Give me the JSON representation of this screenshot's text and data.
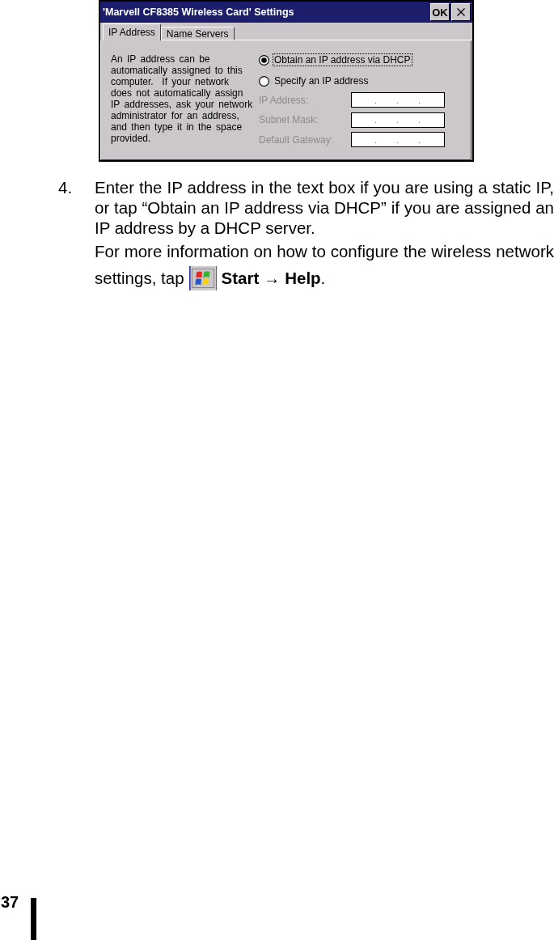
{
  "dialog": {
    "title": "'Marvell CF8385 Wireless Card' Settings",
    "ok_button": "OK",
    "tabs": [
      {
        "label": "IP Address",
        "selected": true
      },
      {
        "label": "Name Servers",
        "selected": false
      }
    ],
    "description": "An IP address can be automatically assigned to this computer.  If your network does not automatically assign IP addresses, ask your network administrator for an address, and then type it in the space provided.",
    "radios": [
      {
        "label": "Obtain an IP address via DHCP",
        "selected": true,
        "focused": true
      },
      {
        "label": "Specify an IP address",
        "selected": false,
        "focused": false
      }
    ],
    "fields": [
      {
        "label": "IP Address:",
        "disabled": true,
        "separators": [
          ".",
          ".",
          "."
        ]
      },
      {
        "label": "Subnet Mask:",
        "disabled": true,
        "separators": [
          ".",
          ".",
          "."
        ]
      },
      {
        "label": "Default Gateway:",
        "disabled": true,
        "separators": [
          ".",
          ".",
          "."
        ]
      }
    ]
  },
  "step": {
    "number": "4.",
    "text": "Enter the IP address in the text box if you are using a static IP, or tap “Obtain an IP address via DHCP” if you are assigned an IP address by a DHCP server.",
    "note_first_line": "For more information on how to configure the wireless network",
    "note_before_icon": "settings, tap",
    "note_after_icon": "**Start** → **Help**."
  },
  "page_number": "37"
}
